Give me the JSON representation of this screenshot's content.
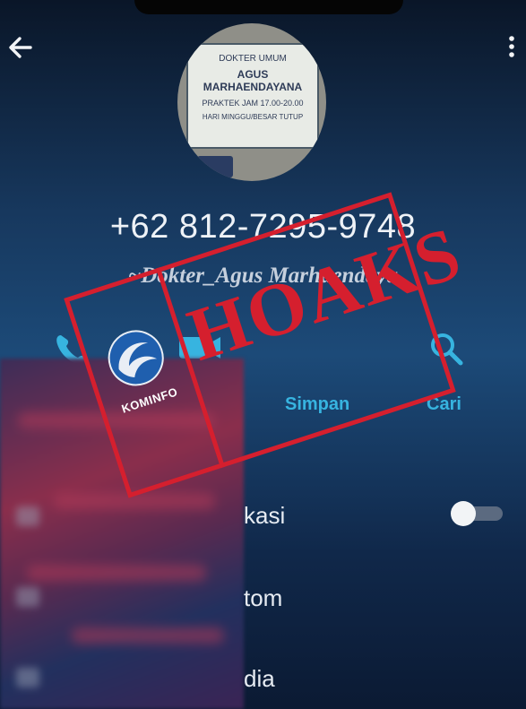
{
  "contact": {
    "phone_number": "+62 812-7295-9748",
    "display_name": "~Dokter_Agus Marhaendaya",
    "photo_sign": {
      "line1": "DOKTER UMUM",
      "line2": "AGUS MARHAENDAYANA",
      "line3": "PRAKTEK JAM 17.00-20.00",
      "line4": "HARI MINGGU/BESAR TUTUP"
    }
  },
  "actions": {
    "call_icon": "phone-icon",
    "video_icon": "video-icon",
    "save_label": "Simpan",
    "search_label": "Cari",
    "search_icon": "search-icon"
  },
  "menu": {
    "items": [
      {
        "label": "kasi",
        "has_toggle": true,
        "toggle_on": false
      },
      {
        "label": "tom"
      },
      {
        "label": "dia"
      }
    ]
  },
  "stamp": {
    "word": "HOAKS",
    "logo_text": "KOMINFO",
    "color": "#d51f2e"
  },
  "colors": {
    "accent": "#37b4e0",
    "stamp_red": "#d51f2e"
  }
}
